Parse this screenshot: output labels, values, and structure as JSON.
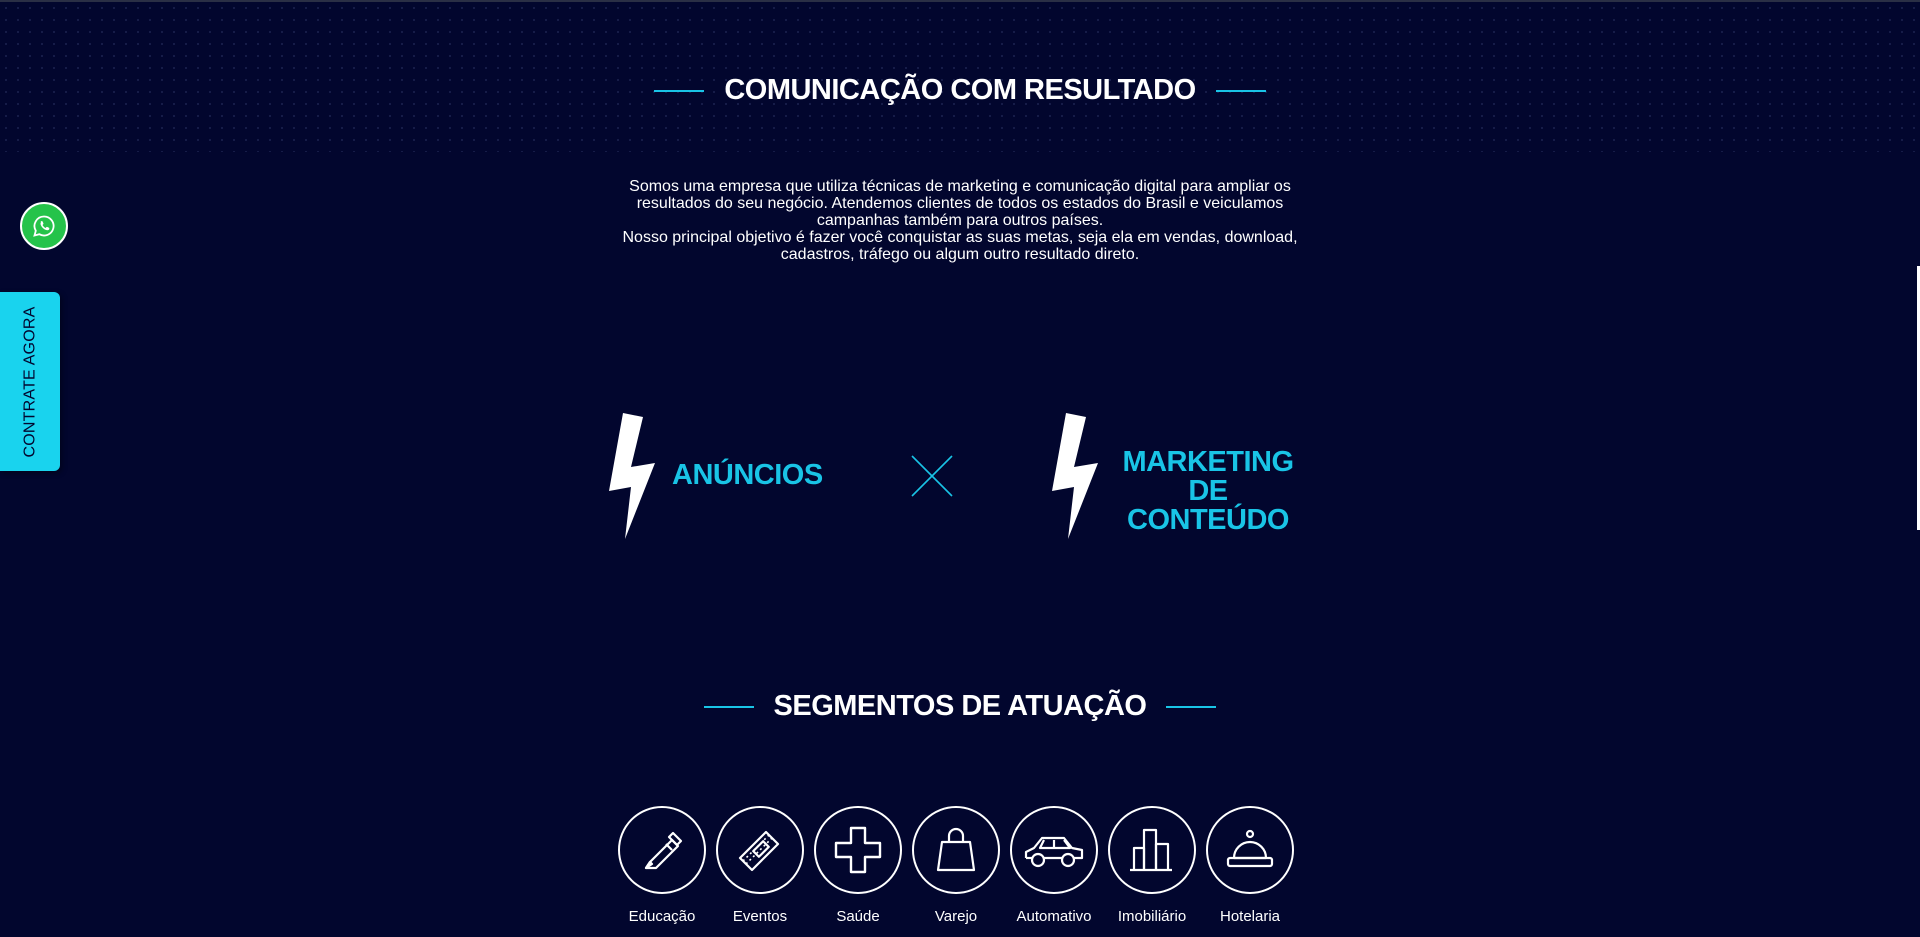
{
  "colors": {
    "background": "#02062e",
    "accent": "#19c4e6",
    "whatsapp": "#25c34a",
    "cta": "#19d3ee"
  },
  "section1": {
    "title": "COMUNICAÇÃO COM RESULTADO",
    "paragraph1": "Somos uma empresa que utiliza técnicas de marketing e comunicação digital para ampliar os resultados do seu negócio. Atendemos clientes de todos os estados do Brasil e veiculamos campanhas também para outros países.",
    "paragraph2": "Nosso principal objetivo é fazer você conquistar as suas metas, seja ela em vendas, download, cadastros, tráfego ou algum outro resultado direto."
  },
  "services": {
    "left": {
      "icon": "lightning-bolt-icon",
      "label": "ANÚNCIOS"
    },
    "separator_icon": "cross-icon",
    "right": {
      "icon": "lightning-bolt-icon",
      "line1": "MARKETING",
      "line2": "DE CONTEÚDO"
    }
  },
  "section2": {
    "title": "SEGMENTOS DE ATUAÇÃO"
  },
  "segments": [
    {
      "label": "Educação",
      "icon": "pencil-icon"
    },
    {
      "label": "Eventos",
      "icon": "ticket-icon"
    },
    {
      "label": "Saúde",
      "icon": "health-cross-icon"
    },
    {
      "label": "Varejo",
      "icon": "shopping-bag-icon"
    },
    {
      "label": "Automativo",
      "icon": "car-icon"
    },
    {
      "label": "Imobiliário",
      "icon": "buildings-icon"
    },
    {
      "label": "Hotelaria",
      "icon": "service-bell-icon"
    }
  ],
  "floating": {
    "whatsapp_icon": "whatsapp-icon",
    "cta_label": "CONTRATE AGORA"
  }
}
